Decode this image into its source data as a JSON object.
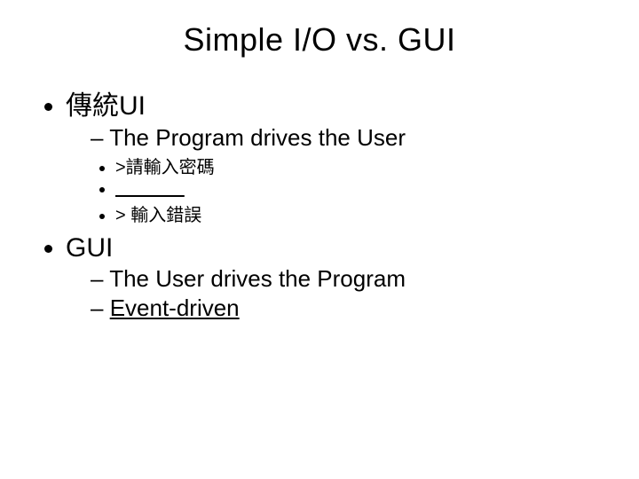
{
  "title": "Simple I/O vs. GUI",
  "sections": [
    {
      "heading": "傳統UI",
      "points": [
        {
          "text": "The Program drives the User",
          "underline": false
        },
        {
          "children": [
            {
              "text": ">請輸入密碼"
            },
            {
              "blank": "              "
            },
            {
              "text": "> 輸入錯誤"
            }
          ]
        }
      ]
    },
    {
      "heading": "GUI",
      "points": [
        {
          "text": "The User drives the Program",
          "underline": false
        },
        {
          "text": "Event-driven",
          "underline": true
        }
      ]
    }
  ]
}
